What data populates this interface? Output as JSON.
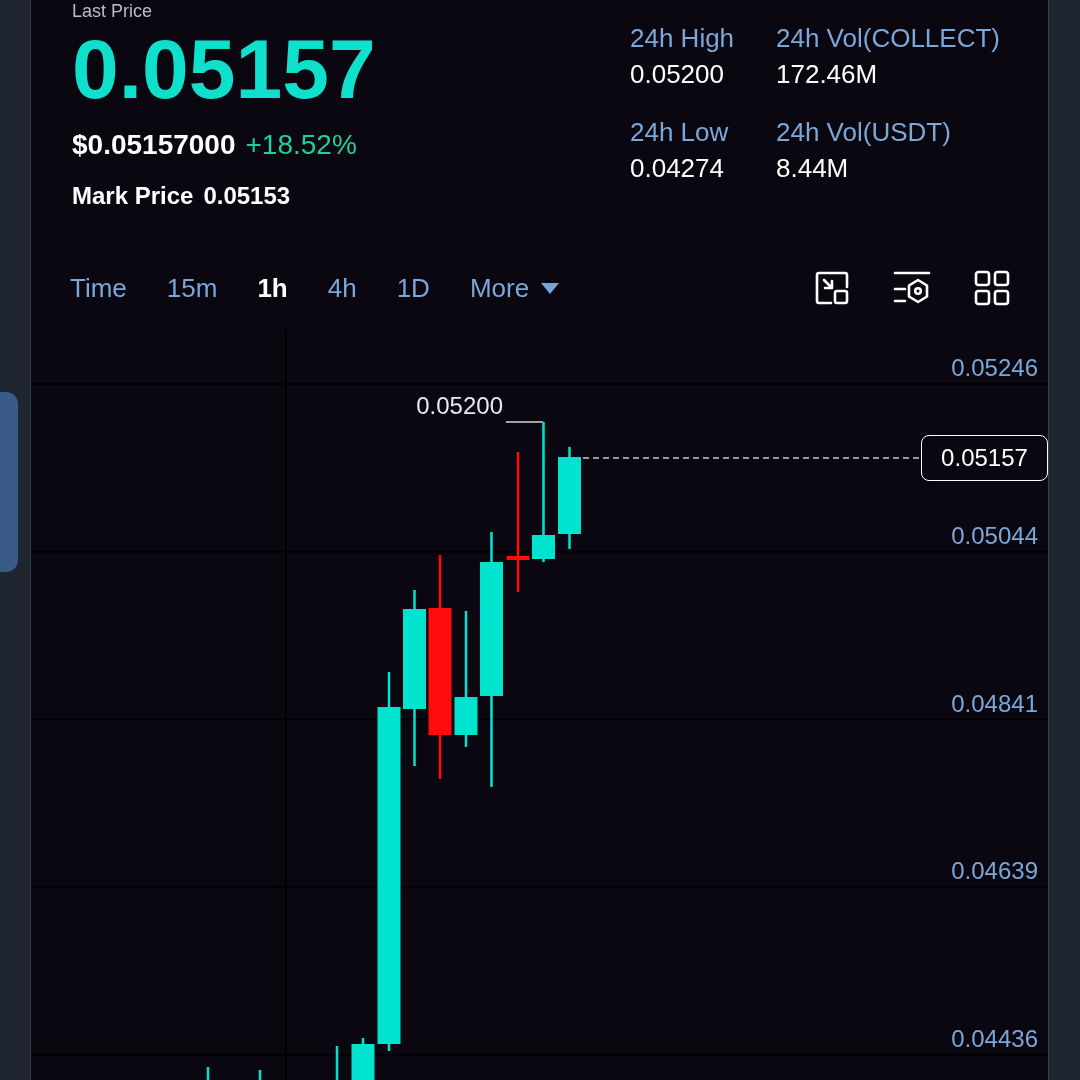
{
  "ticker": {
    "label": "Last Price",
    "price": "0.05157",
    "usd_price": "$0.05157000",
    "change": "+18.52%",
    "mark_price_label": "Mark Price",
    "mark_price": "0.05153"
  },
  "stats": [
    {
      "label": "24h High",
      "value": "0.05200"
    },
    {
      "label": "24h Vol(COLLECT)",
      "value": "172.46M"
    },
    {
      "label": "24h Low",
      "value": "0.04274"
    },
    {
      "label": "24h Vol(USDT)",
      "value": "8.44M"
    }
  ],
  "tabs": [
    {
      "label": "Time",
      "kind": "interval",
      "selected": false
    },
    {
      "label": "15m",
      "kind": "interval",
      "selected": false
    },
    {
      "label": "1h",
      "kind": "interval",
      "selected": true
    },
    {
      "label": "4h",
      "kind": "interval",
      "selected": false
    },
    {
      "label": "1D",
      "kind": "interval",
      "selected": false
    },
    {
      "label": "More",
      "kind": "menu",
      "selected": false
    }
  ],
  "chart": {
    "price_axis": [
      "0.05246",
      "0.05044",
      "0.04841",
      "0.04639",
      "0.04436"
    ],
    "high_label": "0.05200",
    "last_price_tag": "0.05157"
  }
}
